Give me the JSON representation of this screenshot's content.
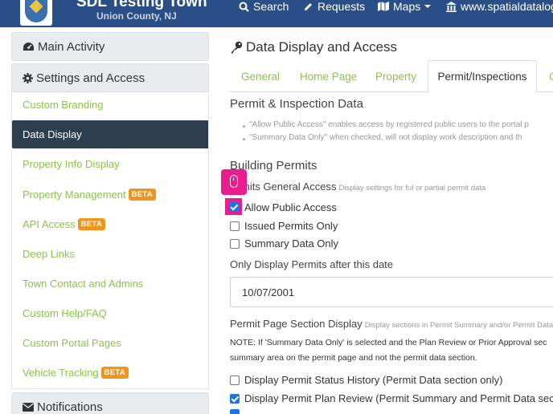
{
  "header": {
    "town_name": "SDL Testing Town",
    "county": "Union County, NJ",
    "nav": {
      "search": "Search",
      "requests": "Requests",
      "maps": "Maps",
      "website": "www.spatialdatalogic"
    }
  },
  "sidebar": {
    "main_activity": "Main Activity",
    "settings_access": "Settings and Access",
    "notifications": "Notifications",
    "items": [
      {
        "label": "Custom Branding"
      },
      {
        "label": "Data Display"
      },
      {
        "label": "Property Info Display"
      },
      {
        "label": "Property Management",
        "badge": "BETA"
      },
      {
        "label": "API Access",
        "badge": "BETA"
      },
      {
        "label": "Deep Links"
      },
      {
        "label": "Town Contact and Admins"
      },
      {
        "label": "Custom Help/FAQ"
      },
      {
        "label": "Custom Portal Pages"
      },
      {
        "label": "Vehicle Tracking",
        "badge": "BETA"
      }
    ]
  },
  "main": {
    "title": "Data Display and Access",
    "tabs": [
      "General",
      "Home Page",
      "Property",
      "Permit/Inspections",
      "C"
    ],
    "permit_section_title": "Permit & Inspection Data",
    "notes": [
      "\"Allow Public Access\" enables access by registered public users to the portal p",
      "\"Summary Data Only\" when checked, will not display work description and th"
    ],
    "building_permits_title": "Building Permits",
    "general_access_label": "mits General Access",
    "general_access_hint": "Display settings for ful or partial permit data",
    "checkboxes": [
      {
        "label": "Allow Public Access",
        "checked": true
      },
      {
        "label": "Issued Permits Only",
        "checked": false
      },
      {
        "label": "Summary Data Only",
        "checked": false
      }
    ],
    "date_label": "Only Display Permits after this date",
    "date_value": "10/07/2001",
    "section_display_label": "Permit Page Section Display",
    "section_display_hint": "Display sections in Permit Summary and/or Permit Data ar",
    "section_note_line1": "NOTE: If 'Summary Data Only' is selected and the Plan Review or Prior Approval sec",
    "section_note_line2": "summary area on the permit page and not the permit data section.",
    "section_checkboxes": [
      {
        "label": "Display Permit Status History (Permit Data section only)",
        "checked": false
      },
      {
        "label": "Display Permit Plan Review (Permit Summary and Permit Data sectio",
        "checked": true
      }
    ]
  }
}
